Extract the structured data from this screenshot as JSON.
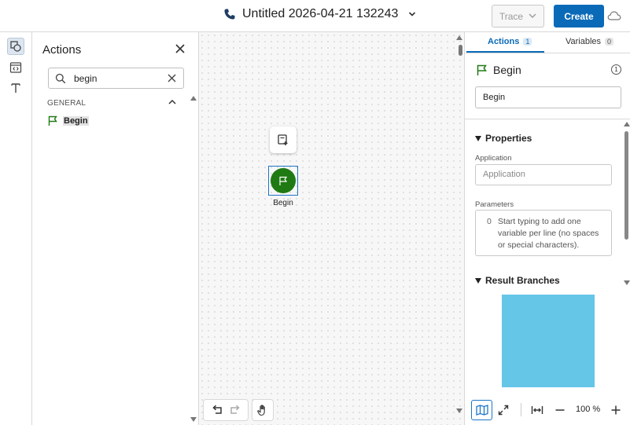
{
  "header": {
    "title": "Untitled 2026-04-21 132243",
    "trace_label": "Trace",
    "create_label": "Create"
  },
  "actions_panel": {
    "title": "Actions",
    "search_value": "begin",
    "group_label": "GENERAL",
    "items": [
      {
        "label": "Begin",
        "icon": "flag-icon"
      }
    ]
  },
  "canvas": {
    "node_label": "Begin"
  },
  "right_panel": {
    "tabs": [
      {
        "label": "Actions",
        "count": "1"
      },
      {
        "label": "Variables",
        "count": "0"
      }
    ],
    "node_title": "Begin",
    "node_index": "1",
    "name_value": "Begin",
    "properties_label": "Properties",
    "application_label": "Application",
    "application_placeholder": "Application",
    "parameters_label": "Parameters",
    "parameters_line": "0",
    "parameters_placeholder": "Start typing to add one variable per line (no spaces or special characters).",
    "result_branches_label": "Result Branches",
    "zoom_text": "100 %"
  },
  "colors": {
    "accent": "#0a6ab8",
    "begin_node": "#1f7a13",
    "minimap": "#65c6e8"
  }
}
